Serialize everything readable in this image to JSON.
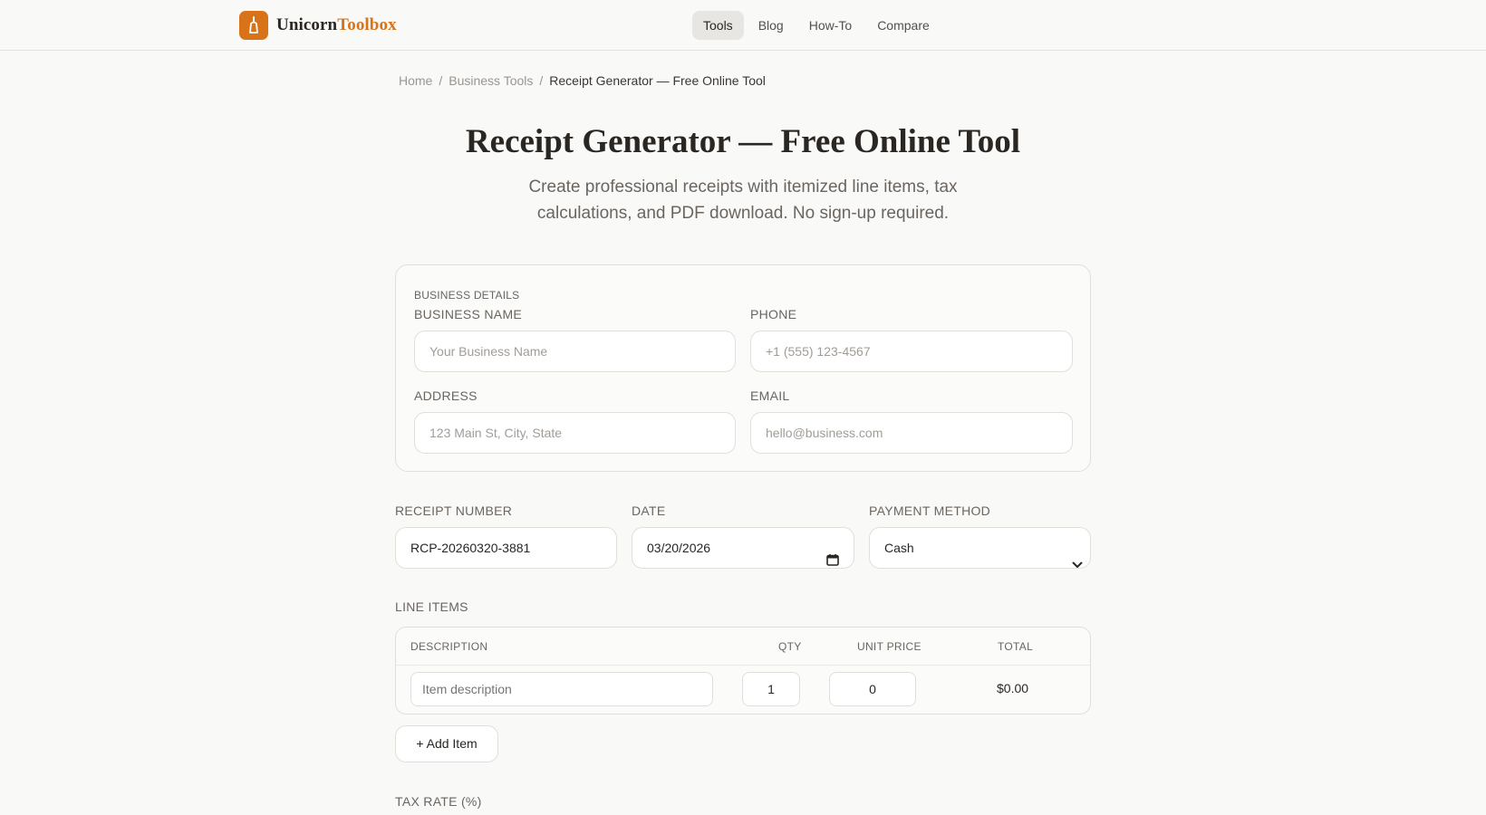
{
  "header": {
    "logo_main": "Unicorn",
    "logo_accent": "Toolbox",
    "nav": [
      {
        "label": "Tools",
        "active": true
      },
      {
        "label": "Blog",
        "active": false
      },
      {
        "label": "How-To",
        "active": false
      },
      {
        "label": "Compare",
        "active": false
      }
    ]
  },
  "breadcrumb": {
    "home": "Home",
    "section": "Business Tools",
    "current": "Receipt Generator — Free Online Tool",
    "separator": "/"
  },
  "page": {
    "title": "Receipt Generator — Free Online Tool",
    "subtitle": "Create professional receipts with itemized line items, tax calculations, and PDF download. No sign-up required."
  },
  "business": {
    "section_label": "BUSINESS DETAILS",
    "name_label": "BUSINESS NAME",
    "name_placeholder": "Your Business Name",
    "phone_label": "PHONE",
    "phone_placeholder": "+1 (555) 123-4567",
    "address_label": "ADDRESS",
    "address_placeholder": "123 Main St, City, State",
    "email_label": "EMAIL",
    "email_placeholder": "hello@business.com"
  },
  "receipt": {
    "number_label": "RECEIPT NUMBER",
    "number_value": "RCP-20260320-3881",
    "date_label": "DATE",
    "date_value": "03/20/2026",
    "payment_label": "PAYMENT METHOD",
    "payment_value": "Cash"
  },
  "line_items": {
    "label": "LINE ITEMS",
    "columns": {
      "description": "DESCRIPTION",
      "qty": "QTY",
      "unit_price": "UNIT PRICE",
      "total": "TOTAL"
    },
    "rows": [
      {
        "description_placeholder": "Item description",
        "qty": "1",
        "unit_price": "0",
        "total": "$0.00"
      }
    ],
    "add_button": "+ Add Item"
  },
  "tax": {
    "label": "TAX RATE (%)"
  },
  "colors": {
    "accent": "#d9731a",
    "background": "#f9f9f8",
    "text": "#2a2622"
  }
}
